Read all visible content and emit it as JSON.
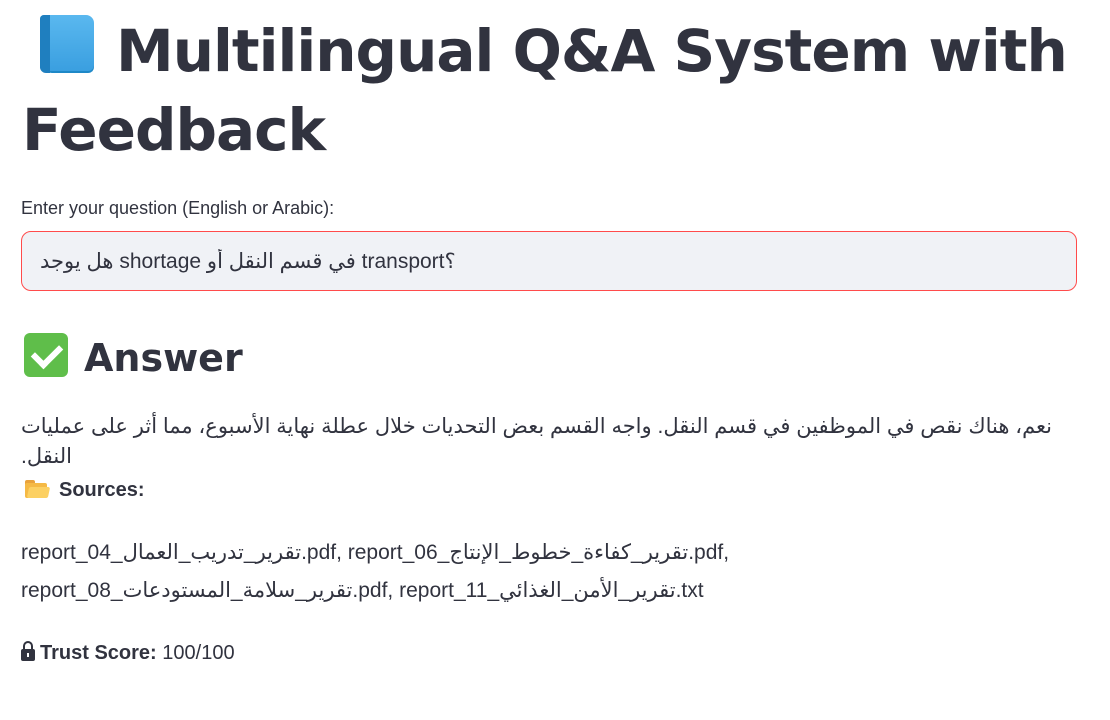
{
  "page": {
    "title": "Multilingual Q&A System with Feedback"
  },
  "question": {
    "label": "Enter your question (English or Arabic):",
    "value": "هل يوجد shortage في قسم النقل أو transport؟"
  },
  "answer": {
    "heading": "Answer",
    "text": "نعم، هناك نقص في الموظفين في قسم النقل. واجه القسم بعض التحديات خلال عطلة نهاية الأسبوع، مما أثر على عمليات النقل."
  },
  "sources": {
    "label": "Sources:",
    "text": "report_04_تقرير_تدريب_العمال.pdf, report_06_تقرير_كفاءة_خطوط_الإنتاج.pdf, report_08_تقرير_سلامة_المستودعات.pdf, report_11_تقرير_الأمن_الغذائي.txt"
  },
  "trust": {
    "label": "Trust Score:",
    "value": "100/100"
  },
  "icons": {
    "title": "book-icon",
    "answer": "check-mark-icon",
    "sources": "folder-icon",
    "trust": "lock-icon"
  },
  "colors": {
    "text": "#31333f",
    "input_background": "#f0f2f6",
    "input_border_focus": "#ff4b4b",
    "check_green": "#5fbe4a"
  }
}
